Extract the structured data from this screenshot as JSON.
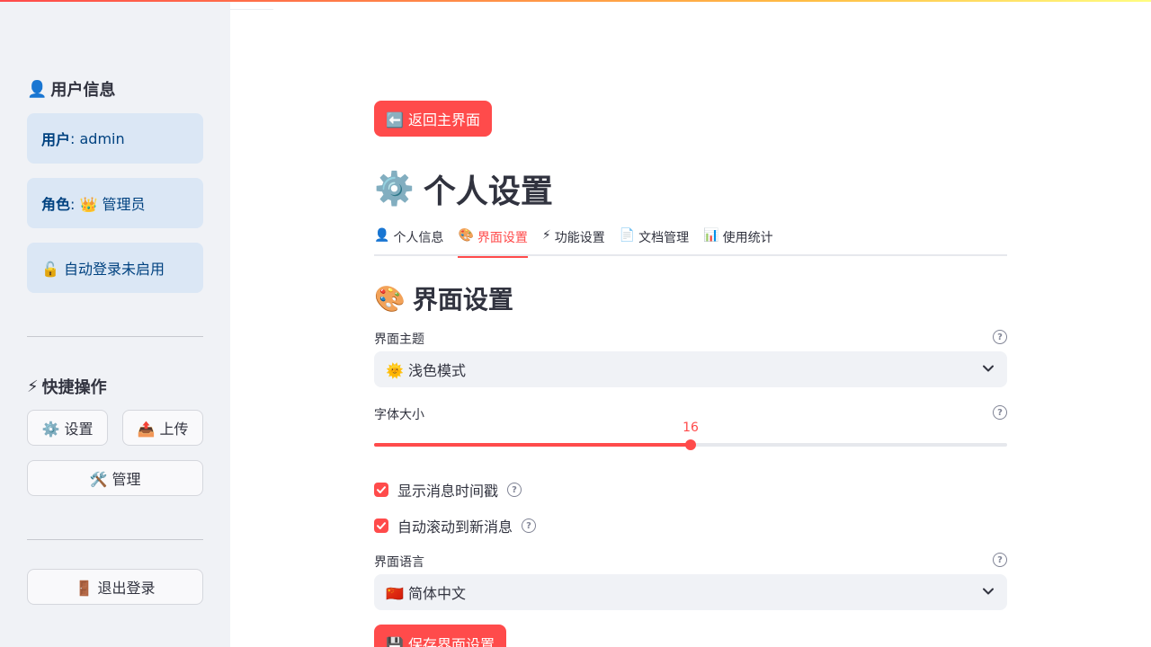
{
  "sidebar": {
    "user_section": {
      "icon": "user-icon",
      "title": "用户信息",
      "user_label": "用户",
      "user_value": ": admin",
      "role_label": "角色",
      "role_value": ": 👑 管理员",
      "autologin": "🔓 自动登录未启用"
    },
    "quick_section": {
      "icon": "lightning-icon",
      "title": "快捷操作",
      "settings_label": "⚙️ 设置",
      "upload_label": "📤 上传",
      "manage_label": "🛠️ 管理"
    },
    "logout_label": "🚪 退出登录"
  },
  "main": {
    "back_button": "⬅️ 返回主界面",
    "page_title_icon": "⚙️",
    "page_title": "个人设置",
    "tabs": [
      {
        "icon": "👤",
        "label": "个人信息",
        "active": false
      },
      {
        "icon": "🎨",
        "label": "界面设置",
        "active": true
      },
      {
        "icon": "⚡",
        "label": "功能设置",
        "active": false
      },
      {
        "icon": "📄",
        "label": "文档管理",
        "active": false
      },
      {
        "icon": "📊",
        "label": "使用统计",
        "active": false
      }
    ],
    "section_icon": "🎨",
    "section_title": "界面设置",
    "theme": {
      "label": "界面主题",
      "value": "🌞 浅色模式"
    },
    "font_size": {
      "label": "字体大小",
      "value": "16",
      "fraction": 0.5
    },
    "show_timestamp": {
      "label": "显示消息时间戳",
      "checked": true
    },
    "auto_scroll": {
      "label": "自动滚动到新消息",
      "checked": true
    },
    "language": {
      "label": "界面语言",
      "value": "🇨🇳 简体中文"
    },
    "save_button": "💾 保存界面设置"
  },
  "colors": {
    "accent": "#ff4b4b",
    "sidebar_bg": "#f0f2f6",
    "info_bg": "#dbe7f5",
    "info_text": "#004280"
  }
}
